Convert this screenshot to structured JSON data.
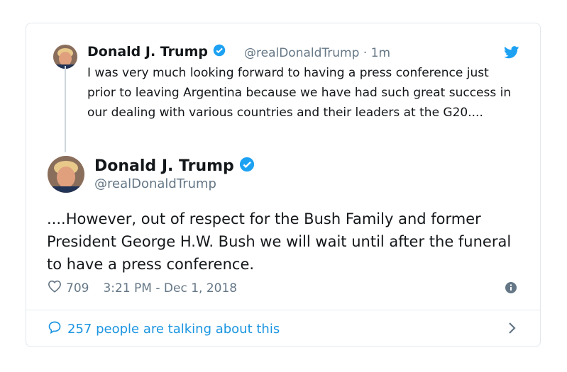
{
  "parent_tweet": {
    "name": "Donald J. Trump",
    "handle": "@realDonaldTrump",
    "separator": "·",
    "time": "1m",
    "text": "I was very much looking forward to having a press conference just prior to leaving Argentina because we have had such great success in our dealing with various countries and their leaders at the G20...."
  },
  "main_tweet": {
    "name": "Donald J. Trump",
    "handle": "@realDonaldTrump",
    "text": "....However, out of respect for the Bush Family and former President George H.W. Bush we will wait until after the funeral to have a press conference.",
    "likes": "709",
    "timestamp": "3:21 PM - Dec 1, 2018"
  },
  "footer": {
    "talking": "257 people are talking about this"
  },
  "colors": {
    "accent": "#1da1f2",
    "link": "#1b95e0",
    "muted": "#657786",
    "border": "#e1e8ed"
  },
  "icons": [
    "verified-badge-icon",
    "twitter-bird-icon",
    "heart-icon",
    "info-icon",
    "speech-bubble-icon",
    "chevron-right-icon"
  ]
}
